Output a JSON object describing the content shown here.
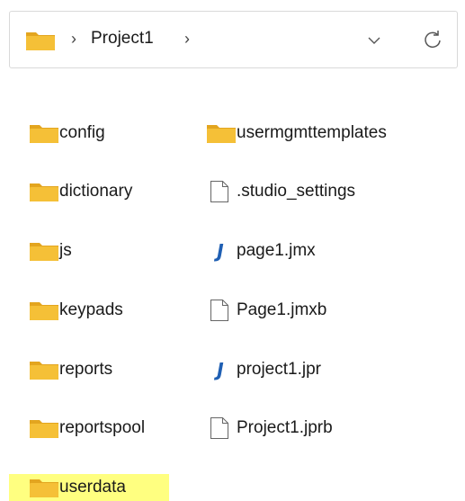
{
  "address_bar": {
    "breadcrumb": "Project1",
    "folder_icon": "folder-icon",
    "separator_icon": "chevron-right-icon",
    "dropdown_icon": "chevron-down-icon",
    "refresh_icon": "refresh-icon"
  },
  "colors": {
    "folder": "#f5c037",
    "folder_dark": "#e3a51f",
    "highlight": "#ffff80",
    "java_icon": "#1f5fb3"
  },
  "items": [
    {
      "name": "config",
      "type": "folder",
      "highlighted": false
    },
    {
      "name": "dictionary",
      "type": "folder",
      "highlighted": false
    },
    {
      "name": "js",
      "type": "folder",
      "highlighted": false
    },
    {
      "name": "keypads",
      "type": "folder",
      "highlighted": false
    },
    {
      "name": "reports",
      "type": "folder",
      "highlighted": false
    },
    {
      "name": "reportspool",
      "type": "folder",
      "highlighted": false
    },
    {
      "name": "userdata",
      "type": "folder",
      "highlighted": true
    },
    {
      "name": "usermgmttemplates",
      "type": "folder",
      "highlighted": false
    },
    {
      "name": ".studio_settings",
      "type": "file",
      "highlighted": false
    },
    {
      "name": "page1.jmx",
      "type": "jide-file",
      "highlighted": false
    },
    {
      "name": "Page1.jmxb",
      "type": "file",
      "highlighted": false
    },
    {
      "name": "project1.jpr",
      "type": "jide-file",
      "highlighted": false
    },
    {
      "name": "Project1.jprb",
      "type": "file",
      "highlighted": false
    }
  ]
}
